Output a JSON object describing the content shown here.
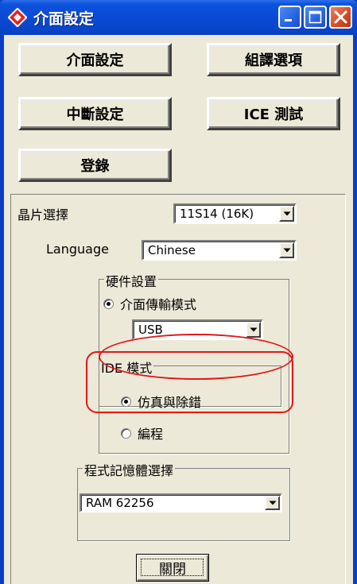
{
  "window": {
    "title": "介面設定"
  },
  "buttons": {
    "interface_setup": "介面設定",
    "compile_options": "組譯選項",
    "interrupt_setup": "中斷設定",
    "ice_test": "ICE 測試",
    "login": "登錄"
  },
  "settings": {
    "chip_select_label": "晶片選擇",
    "chip_select_value": "11S14 (16K)",
    "language_label": "Language",
    "language_value": "Chinese",
    "hardware_group_title": "硬件設置",
    "interface_mode_label": "介面傳輸模式",
    "interface_mode_checked": true,
    "transport_value": "USB",
    "ide_group_title": "IDE 模式",
    "emulate_debug_label": "仿真與除錯",
    "emulate_debug_checked": true,
    "program_label": "編程",
    "program_checked": false,
    "memory_group_title": "程式記憶體選擇",
    "memory_value": "RAM 62256"
  },
  "footer": {
    "close_label": "關閉"
  },
  "colors": {
    "titlebar": "#0a48d4",
    "face": "#ece9d8",
    "annotation": "#e01818"
  }
}
